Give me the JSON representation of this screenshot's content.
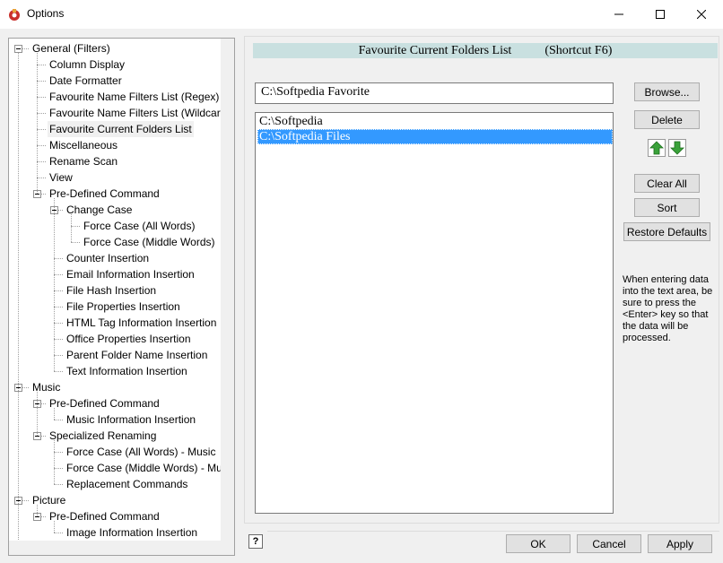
{
  "window": {
    "title": "Options",
    "controls": {
      "minimize": "minimize-icon",
      "maximize": "maximize-icon",
      "close": "close-icon"
    }
  },
  "tree": {
    "items": [
      {
        "label": "General  (Filters)",
        "level": 0,
        "expanded": true
      },
      {
        "label": "Column Display",
        "level": 1
      },
      {
        "label": "Date Formatter",
        "level": 1
      },
      {
        "label": "Favourite Name Filters List (Regex)",
        "level": 1
      },
      {
        "label": "Favourite Name Filters List (Wildcard",
        "level": 1
      },
      {
        "label": "Favourite Current Folders List",
        "level": 1,
        "selected": true
      },
      {
        "label": "Miscellaneous",
        "level": 1
      },
      {
        "label": "Rename Scan",
        "level": 1
      },
      {
        "label": "View",
        "level": 1
      },
      {
        "label": "Pre-Defined Command",
        "level": 1,
        "expanded": true
      },
      {
        "label": "Change Case",
        "level": 2,
        "expanded": true
      },
      {
        "label": "Force Case (All Words)",
        "level": 3
      },
      {
        "label": "Force Case (Middle Words)",
        "level": 3
      },
      {
        "label": "Counter Insertion",
        "level": 2
      },
      {
        "label": "Email Information Insertion",
        "level": 2
      },
      {
        "label": "File Hash Insertion",
        "level": 2
      },
      {
        "label": "File Properties Insertion",
        "level": 2
      },
      {
        "label": "HTML Tag Information Insertion",
        "level": 2
      },
      {
        "label": "Office Properties Insertion",
        "level": 2
      },
      {
        "label": "Parent Folder Name Insertion",
        "level": 2
      },
      {
        "label": "Text Information Insertion",
        "level": 2
      },
      {
        "label": "Music",
        "level": 0,
        "expanded": true
      },
      {
        "label": "Pre-Defined Command",
        "level": 1,
        "expanded": true
      },
      {
        "label": "Music Information Insertion",
        "level": 2
      },
      {
        "label": "Specialized Renaming",
        "level": 1,
        "expanded": true
      },
      {
        "label": "Force Case (All Words) - Music",
        "level": 2
      },
      {
        "label": "Force Case (Middle Words) - Mu",
        "level": 2
      },
      {
        "label": "Replacement Commands",
        "level": 2
      },
      {
        "label": "Picture",
        "level": 0,
        "expanded": true
      },
      {
        "label": "Pre-Defined Command",
        "level": 1,
        "expanded": true
      },
      {
        "label": "Image Information Insertion",
        "level": 2
      }
    ]
  },
  "panel": {
    "header_title": "Favourite Current Folders List",
    "header_shortcut": "(Shortcut F6)",
    "input_value": "C:\\Softpedia Favorite",
    "list_items": [
      {
        "label": "C:\\Softpedia",
        "selected": false
      },
      {
        "label": "C:\\Softpedia Files",
        "selected": true
      }
    ],
    "buttons": {
      "browse": "Browse...",
      "delete": "Delete",
      "clear_all": "Clear All",
      "sort": "Sort",
      "restore_defaults": "Restore Defaults"
    },
    "hint": "When entering data into the text area, be sure to press the <Enter> key so that the data will be processed."
  },
  "footer": {
    "help": "?",
    "ok": "OK",
    "cancel": "Cancel",
    "apply": "Apply"
  },
  "colors": {
    "header_bg": "#c9e0e0",
    "selection": "#3399ff",
    "arrow_green": "#3aa23a"
  }
}
